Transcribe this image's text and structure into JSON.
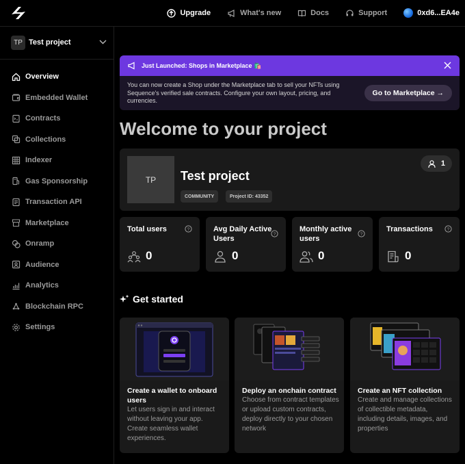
{
  "topbar": {
    "upgrade": "Upgrade",
    "whats_new": "What's new",
    "docs": "Docs",
    "support": "Support",
    "wallet": "0xd6...EA4e"
  },
  "sidebar": {
    "project_avatar": "TP",
    "project_name": "Test project",
    "items": [
      {
        "label": "Overview",
        "icon": "home-icon",
        "active": true
      },
      {
        "label": "Embedded Wallet",
        "icon": "wallet-icon"
      },
      {
        "label": "Contracts",
        "icon": "contract-icon"
      },
      {
        "label": "Collections",
        "icon": "collections-icon"
      },
      {
        "label": "Indexer",
        "icon": "grid-icon"
      },
      {
        "label": "Gas Sponsorship",
        "icon": "gas-pump-icon"
      },
      {
        "label": "Transaction API",
        "icon": "document-icon"
      },
      {
        "label": "Marketplace",
        "icon": "store-icon"
      },
      {
        "label": "Onramp",
        "icon": "coins-icon"
      },
      {
        "label": "Audience",
        "icon": "audience-icon"
      },
      {
        "label": "Analytics",
        "icon": "bar-chart-icon"
      },
      {
        "label": "Blockchain RPC",
        "icon": "rpc-icon"
      },
      {
        "label": "Settings",
        "icon": "gear-icon"
      }
    ]
  },
  "banner": {
    "title": "Just Launched: Shops in Marketplace 🛍️",
    "text": "You can now create a Shop under the Marketplace tab to sell your NFTs using Sequence's verified sale contracts. Configure your own layout, pricing, and currencies.",
    "button": "Go to Marketplace →",
    "color": "#6d38e0"
  },
  "welcome": "Welcome to your project",
  "project": {
    "thumb": "TP",
    "name": "Test project",
    "tier": "COMMUNITY",
    "id_label": "Project ID: 43352",
    "members": "1"
  },
  "stats": [
    {
      "label": "Total users",
      "value": "0",
      "icon": "users-network-icon"
    },
    {
      "label": "Avg Daily Active Users",
      "value": "0",
      "icon": "user-icon"
    },
    {
      "label": "Monthly active users",
      "value": "0",
      "icon": "users-icon"
    },
    {
      "label": "Transactions",
      "value": "0",
      "icon": "receipt-icon"
    }
  ],
  "get_started": {
    "title": "Get started",
    "cards": [
      {
        "title": "Create a wallet to onboard users",
        "desc": "Let users sign in and interact without leaving your app. Create seamless wallet experiences."
      },
      {
        "title": "Deploy an onchain contract",
        "desc": "Choose from contract templates or upload custom contracts, deploy directly to your chosen network"
      },
      {
        "title": "Create an NFT collection",
        "desc": "Create and manage collections of collectible metadata, including details, images, and properties"
      }
    ]
  }
}
